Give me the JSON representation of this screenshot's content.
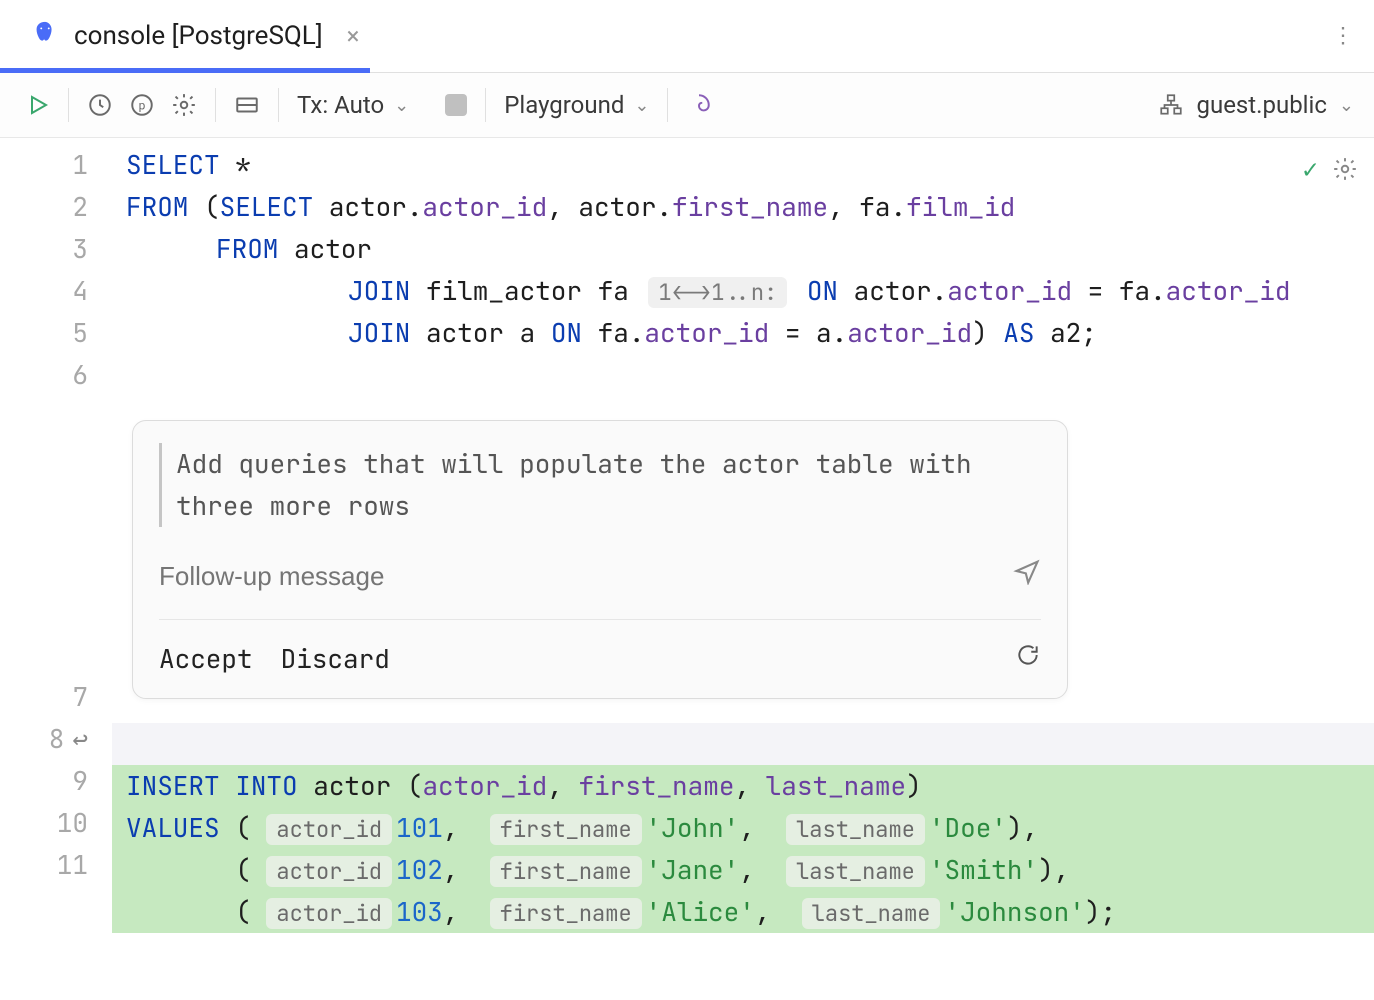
{
  "tab": {
    "title": "console [PostgreSQL]"
  },
  "toolbar": {
    "tx_label": "Tx: Auto",
    "playground_label": "Playground",
    "schema_label": "guest.public"
  },
  "editor": {
    "lines": [
      "1",
      "2",
      "3",
      "4",
      "5",
      "6",
      "7",
      "8",
      "9",
      "10",
      "11"
    ],
    "join_hint": "1<->1..n:",
    "code": {
      "l1_select": "SELECT",
      "l1_star": " *",
      "l2_from": "FROM",
      "l2_open": " (",
      "l2_select": "SELECT",
      "l2_cols": " actor.",
      "l2_aid": "actor_id",
      "l2_c1": ", actor.",
      "l2_fn": "first_name",
      "l2_c2": ", fa.",
      "l2_fid": "film_id",
      "l3_from": "FROM",
      "l3_actor": " actor",
      "l4_join": "JOIN",
      "l4_fa": " film_actor fa ",
      "l4_on": " ON",
      "l4_cond": " actor.",
      "l4_aid": "actor_id",
      "l4_eq": " = fa.",
      "l4_aid2": "actor_id",
      "l5_join": "JOIN",
      "l5_a": " actor a ",
      "l5_on": "ON",
      "l5_cond": " fa.",
      "l5_aid": "actor_id",
      "l5_eq": " = a.",
      "l5_aid2": "actor_id",
      "l5_close": ") ",
      "l5_as": "AS",
      "l5_alias": " a2;"
    }
  },
  "ai": {
    "prompt": "Add queries that will populate the actor table with three more rows",
    "followup_placeholder": "Follow-up message",
    "accept": "Accept",
    "discard": "Discard"
  },
  "insert": {
    "kw_insert": "INSERT",
    "kw_into": "INTO",
    "table": " actor ",
    "open": "(",
    "c_aid": "actor_id",
    "c_fn": "first_name",
    "c_ln": "last_name",
    "close": ")",
    "kw_values": "VALUES",
    "rows": [
      {
        "id": "101",
        "fn": "'John'",
        "ln": "'Doe'",
        "end": ","
      },
      {
        "id": "102",
        "fn": "'Jane'",
        "ln": "'Smith'",
        "end": ","
      },
      {
        "id": "103",
        "fn": "'Alice'",
        "ln": "'Johnson'",
        "end": ";"
      }
    ],
    "h_aid": "actor_id",
    "h_fn": "first_name",
    "h_ln": "last_name"
  }
}
